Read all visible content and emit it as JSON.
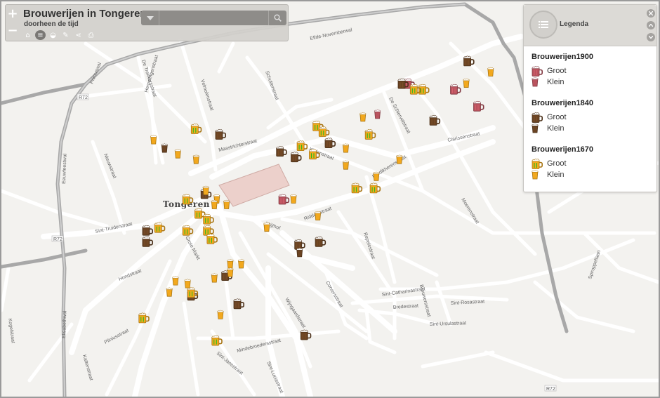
{
  "app": {
    "title": "Brouwerijen in Tongeren",
    "subtitle": "doorheen de tijd"
  },
  "zoom": {
    "in_label": "+",
    "out_label": "−"
  },
  "search": {
    "placeholder": "",
    "value": ""
  },
  "toolbar": {
    "tools": [
      {
        "name": "home-icon",
        "glyph": "⌂"
      },
      {
        "name": "list-icon",
        "glyph": "≡"
      },
      {
        "name": "layers-icon",
        "glyph": "◒"
      },
      {
        "name": "draw-icon",
        "glyph": "✎"
      },
      {
        "name": "share-icon",
        "glyph": "⋖"
      },
      {
        "name": "print-icon",
        "glyph": "⎙"
      }
    ]
  },
  "legend": {
    "title": "Legenda",
    "groups": [
      {
        "title": "Brouwerijen1900",
        "color": "#b9535e",
        "items": [
          {
            "label": "Groot",
            "size": "big"
          },
          {
            "label": "Klein",
            "size": "small"
          }
        ]
      },
      {
        "title": "Brouwerijen1840",
        "color": "#6b4423",
        "items": [
          {
            "label": "Groot",
            "size": "big"
          },
          {
            "label": "Klein",
            "size": "small"
          }
        ]
      },
      {
        "title": "Brouwerijen1670",
        "color": "#f2a81d",
        "items": [
          {
            "label": "Groot",
            "size": "big"
          },
          {
            "label": "Klein",
            "size": "small"
          }
        ]
      }
    ]
  },
  "map": {
    "town_label": "Tongeren",
    "road_shields": [
      "R72",
      "R72",
      "R72"
    ],
    "street_labels": [
      "Elfde-Novemberwal",
      "Primuswal",
      "Eeuwfeestwal",
      "Elisabethwal",
      "De Schiervelstraat",
      "Maastrichterstraat",
      "Clarissenstraat",
      "Kielenstraat",
      "Predikherenstraat",
      "Moerenstraat",
      "Sint-Truiderstraat",
      "Hondstraat",
      "Pliniusstraat",
      "Grote Markt",
      "Vrijthof",
      "Riddersstraat",
      "Repelsstraat",
      "Sint-Catharinastraat",
      "Bredestraat",
      "Sint-Rosastraat",
      "Sint-Ursulastraat",
      "Brouwersstraat",
      "Mindebroedersstraat",
      "Wijngaardstraat",
      "Corversstraat",
      "Sint-Jansstraat",
      "Sint-Luciastraat",
      "Kattenstraat",
      "Kogelstraat",
      "Hemelingenstraat",
      "De Trekkersstraat",
      "Velmolenstraat",
      "Schutterstraat",
      "Nieuwstraat",
      "Spiroppellaan",
      "Kielenstraat",
      "Vlaamsestraat",
      "Visschersstraat",
      "Moriaanstraat",
      "Kloostraat",
      "Sint-Jozefsstraat",
      "Muntstraat",
      "Grauwpoort",
      "Wijkstraat",
      "Ridderstraat"
    ]
  },
  "markers": [
    {
      "era": "1900",
      "size": "big",
      "lon": 5.4755,
      "lat": 50.7851
    },
    {
      "era": "1900",
      "size": "big",
      "lon": 5.4793,
      "lat": 50.7849
    },
    {
      "era": "1900",
      "size": "big",
      "lon": 5.4812,
      "lat": 50.7843
    },
    {
      "era": "1900",
      "size": "big",
      "lon": 5.4652,
      "lat": 50.781
    },
    {
      "era": "1900",
      "size": "small",
      "lon": 5.4729,
      "lat": 50.784
    },
    {
      "era": "1840",
      "size": "big",
      "lon": 5.475,
      "lat": 50.7851
    },
    {
      "era": "1840",
      "size": "big",
      "lon": 5.4804,
      "lat": 50.7859
    },
    {
      "era": "1840",
      "size": "big",
      "lon": 5.4776,
      "lat": 50.7838
    },
    {
      "era": "1840",
      "size": "big",
      "lon": 5.469,
      "lat": 50.783
    },
    {
      "era": "1840",
      "size": "big",
      "lon": 5.465,
      "lat": 50.7827
    },
    {
      "era": "1840",
      "size": "big",
      "lon": 5.46,
      "lat": 50.7833
    },
    {
      "era": "1840",
      "size": "big",
      "lon": 5.4662,
      "lat": 50.7825
    },
    {
      "era": "1840",
      "size": "big",
      "lon": 5.4588,
      "lat": 50.7812
    },
    {
      "era": "1840",
      "size": "big",
      "lon": 5.454,
      "lat": 50.7799
    },
    {
      "era": "1840",
      "size": "big",
      "lon": 5.454,
      "lat": 50.7795
    },
    {
      "era": "1840",
      "size": "big",
      "lon": 5.4665,
      "lat": 50.7794
    },
    {
      "era": "1840",
      "size": "big",
      "lon": 5.4682,
      "lat": 50.7795
    },
    {
      "era": "1840",
      "size": "big",
      "lon": 5.4605,
      "lat": 50.7783
    },
    {
      "era": "1840",
      "size": "big",
      "lon": 5.4577,
      "lat": 50.7776
    },
    {
      "era": "1840",
      "size": "big",
      "lon": 5.4615,
      "lat": 50.7773
    },
    {
      "era": "1840",
      "size": "big",
      "lon": 5.467,
      "lat": 50.7762
    },
    {
      "era": "1840",
      "size": "small",
      "lon": 5.4554,
      "lat": 50.7828
    },
    {
      "era": "1840",
      "size": "small",
      "lon": 5.4665,
      "lat": 50.7791
    },
    {
      "era": "1670",
      "size": "big",
      "lon": 5.458,
      "lat": 50.7835
    },
    {
      "era": "1670",
      "size": "big",
      "lon": 5.468,
      "lat": 50.7836
    },
    {
      "era": "1670",
      "size": "big",
      "lon": 5.4685,
      "lat": 50.7834
    },
    {
      "era": "1670",
      "size": "big",
      "lon": 5.4723,
      "lat": 50.7833
    },
    {
      "era": "1670",
      "size": "big",
      "lon": 5.4667,
      "lat": 50.7829
    },
    {
      "era": "1670",
      "size": "big",
      "lon": 5.4677,
      "lat": 50.7826
    },
    {
      "era": "1670",
      "size": "big",
      "lon": 5.4767,
      "lat": 50.7849
    },
    {
      "era": "1670",
      "size": "big",
      "lon": 5.476,
      "lat": 50.7849
    },
    {
      "era": "1670",
      "size": "big",
      "lon": 5.4712,
      "lat": 50.7814
    },
    {
      "era": "1670",
      "size": "big",
      "lon": 5.4727,
      "lat": 50.7814
    },
    {
      "era": "1670",
      "size": "big",
      "lon": 5.4573,
      "lat": 50.781
    },
    {
      "era": "1670",
      "size": "big",
      "lon": 5.4583,
      "lat": 50.7805
    },
    {
      "era": "1670",
      "size": "big",
      "lon": 5.459,
      "lat": 50.7803
    },
    {
      "era": "1670",
      "size": "big",
      "lon": 5.459,
      "lat": 50.7799
    },
    {
      "era": "1670",
      "size": "big",
      "lon": 5.4593,
      "lat": 50.7796
    },
    {
      "era": "1670",
      "size": "big",
      "lon": 5.4573,
      "lat": 50.7799
    },
    {
      "era": "1670",
      "size": "big",
      "lon": 5.455,
      "lat": 50.78
    },
    {
      "era": "1670",
      "size": "big",
      "lon": 5.4577,
      "lat": 50.7777
    },
    {
      "era": "1670",
      "size": "big",
      "lon": 5.4537,
      "lat": 50.7768
    },
    {
      "era": "1670",
      "size": "big",
      "lon": 5.4597,
      "lat": 50.776
    },
    {
      "era": "1670",
      "size": "small",
      "lon": 5.4545,
      "lat": 50.7831
    },
    {
      "era": "1670",
      "size": "small",
      "lon": 5.4565,
      "lat": 50.7826
    },
    {
      "era": "1670",
      "size": "small",
      "lon": 5.458,
      "lat": 50.7824
    },
    {
      "era": "1670",
      "size": "small",
      "lon": 5.4588,
      "lat": 50.7813
    },
    {
      "era": "1670",
      "size": "small",
      "lon": 5.4597,
      "lat": 50.781
    },
    {
      "era": "1670",
      "size": "small",
      "lon": 5.4595,
      "lat": 50.7808
    },
    {
      "era": "1670",
      "size": "small",
      "lon": 5.4605,
      "lat": 50.7808
    },
    {
      "era": "1670",
      "size": "small",
      "lon": 5.4638,
      "lat": 50.78
    },
    {
      "era": "1670",
      "size": "small",
      "lon": 5.466,
      "lat": 50.781
    },
    {
      "era": "1670",
      "size": "small",
      "lon": 5.468,
      "lat": 50.7804
    },
    {
      "era": "1670",
      "size": "small",
      "lon": 5.4703,
      "lat": 50.7828
    },
    {
      "era": "1670",
      "size": "small",
      "lon": 5.4717,
      "lat": 50.7839
    },
    {
      "era": "1670",
      "size": "small",
      "lon": 5.4703,
      "lat": 50.7822
    },
    {
      "era": "1670",
      "size": "small",
      "lon": 5.4728,
      "lat": 50.7818
    },
    {
      "era": "1670",
      "size": "small",
      "lon": 5.4747,
      "lat": 50.7824
    },
    {
      "era": "1670",
      "size": "small",
      "lon": 5.4802,
      "lat": 50.7851
    },
    {
      "era": "1670",
      "size": "small",
      "lon": 5.4822,
      "lat": 50.7855
    },
    {
      "era": "1670",
      "size": "small",
      "lon": 5.4855,
      "lat": 50.7858
    },
    {
      "era": "1670",
      "size": "small",
      "lon": 5.4608,
      "lat": 50.7787
    },
    {
      "era": "1670",
      "size": "small",
      "lon": 5.4617,
      "lat": 50.7787
    },
    {
      "era": "1670",
      "size": "small",
      "lon": 5.4608,
      "lat": 50.7784
    },
    {
      "era": "1670",
      "size": "small",
      "lon": 5.4595,
      "lat": 50.7782
    },
    {
      "era": "1670",
      "size": "small",
      "lon": 5.4573,
      "lat": 50.778
    },
    {
      "era": "1670",
      "size": "small",
      "lon": 5.4563,
      "lat": 50.7781
    },
    {
      "era": "1670",
      "size": "small",
      "lon": 5.4558,
      "lat": 50.7777
    },
    {
      "era": "1670",
      "size": "small",
      "lon": 5.46,
      "lat": 50.7769
    }
  ]
}
